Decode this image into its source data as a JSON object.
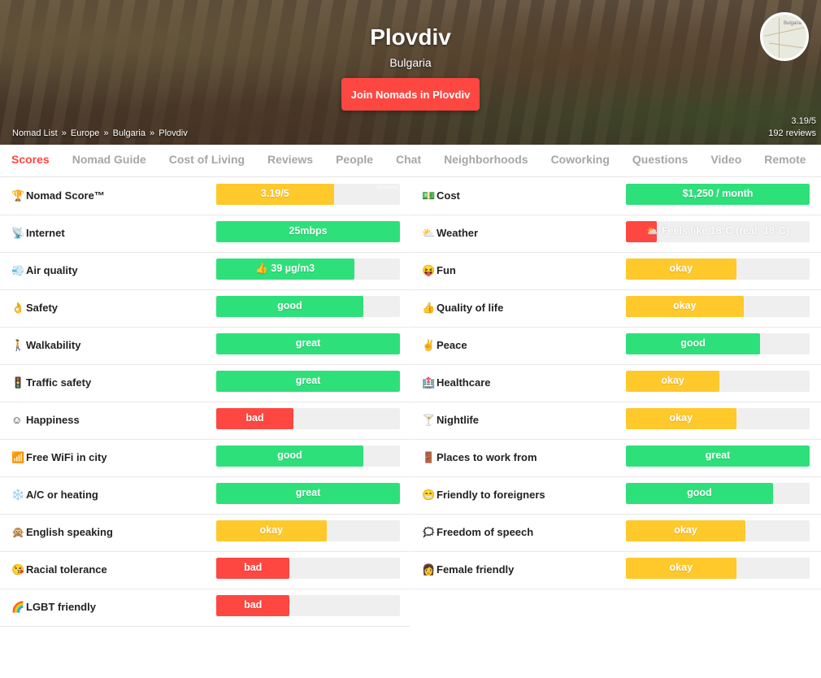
{
  "hero": {
    "city": "Plovdiv",
    "country": "Bulgaria",
    "join_button": "Join Nomads in Plovdiv",
    "map_label": "Bulgaria",
    "breadcrumb": [
      "Nomad List",
      "Europe",
      "Bulgaria",
      "Plovdiv"
    ],
    "breadcrumb_sep": "»",
    "rating": "3.19/5",
    "reviews": "192 reviews"
  },
  "tabs": [
    "Scores",
    "Nomad Guide",
    "Cost of Living",
    "Reviews",
    "People",
    "Chat",
    "Neighborhoods",
    "Coworking",
    "Questions",
    "Video",
    "Remote"
  ],
  "colors": {
    "green": "#2ee07a",
    "yellow": "#ffc82b",
    "red": "#ff4742",
    "track": "#efefef",
    "accent": "#ff4742"
  },
  "left_scores": [
    {
      "icon": "🏆",
      "icon_name": "trophy-icon",
      "label": "Nomad Score™",
      "value": "3.19/5",
      "fill": 0.64,
      "color": "yellow",
      "note": "192 reviews"
    },
    {
      "icon": "📡",
      "icon_name": "satellite-icon",
      "label": "Internet",
      "value": "25mbps",
      "fill": 1.0,
      "color": "green"
    },
    {
      "icon": "💨",
      "icon_name": "wind-icon",
      "label": "Air quality",
      "value": "👍 39 µg/m3",
      "fill": 0.75,
      "color": "green"
    },
    {
      "icon": "👌",
      "icon_name": "ok-hand-icon",
      "label": "Safety",
      "value": "good",
      "fill": 0.8,
      "color": "green"
    },
    {
      "icon": "🚶",
      "icon_name": "walking-person-icon",
      "label": "Walkability",
      "value": "great",
      "fill": 1.0,
      "color": "green"
    },
    {
      "icon": "🚦",
      "icon_name": "traffic-light-icon",
      "label": "Traffic safety",
      "value": "great",
      "fill": 1.0,
      "color": "green"
    },
    {
      "icon": "☺",
      "icon_name": "smile-icon",
      "label": "Happiness",
      "value": "bad",
      "fill": 0.42,
      "color": "red"
    },
    {
      "icon": "📶",
      "icon_name": "wifi-signal-icon",
      "label": "Free WiFi in city",
      "value": "good",
      "fill": 0.8,
      "color": "green"
    },
    {
      "icon": "❄️",
      "icon_name": "snowflake-icon",
      "label": "A/C or heating",
      "value": "great",
      "fill": 1.0,
      "color": "green"
    },
    {
      "icon": "🙊",
      "icon_name": "speak-no-evil-monkey-icon",
      "label": "English speaking",
      "value": "okay",
      "fill": 0.6,
      "color": "yellow"
    },
    {
      "icon": "😘",
      "icon_name": "kiss-face-icon",
      "label": "Racial tolerance",
      "value": "bad",
      "fill": 0.4,
      "color": "red"
    },
    {
      "icon": "🌈",
      "icon_name": "rainbow-icon",
      "label": "LGBT friendly",
      "value": "bad",
      "fill": 0.4,
      "color": "red"
    }
  ],
  "right_scores": [
    {
      "icon": "💵",
      "icon_name": "money-icon",
      "label": "Cost",
      "value": "$1,250 / month",
      "fill": 1.0,
      "color": "green"
    },
    {
      "icon": "⛅",
      "icon_name": "partly-cloudy-icon",
      "label": "Weather",
      "value": "⛅ Feels like 18°C (real: 18°C)",
      "fill": 0.17,
      "color": "red"
    },
    {
      "icon": "😝",
      "icon_name": "tongue-face-icon",
      "label": "Fun",
      "value": "okay",
      "fill": 0.6,
      "color": "yellow"
    },
    {
      "icon": "👍",
      "icon_name": "thumbs-up-icon",
      "label": "Quality of life",
      "value": "okay",
      "fill": 0.64,
      "color": "yellow"
    },
    {
      "icon": "✌️",
      "icon_name": "peace-hand-icon",
      "label": "Peace",
      "value": "good",
      "fill": 0.73,
      "color": "green"
    },
    {
      "icon": "🏥",
      "icon_name": "hospital-icon",
      "label": "Healthcare",
      "value": "okay",
      "fill": 0.51,
      "color": "yellow"
    },
    {
      "icon": "🍸",
      "icon_name": "cocktail-icon",
      "label": "Nightlife",
      "value": "okay",
      "fill": 0.6,
      "color": "yellow"
    },
    {
      "icon": "🚪",
      "icon_name": "door-icon",
      "label": "Places to work from",
      "value": "great",
      "fill": 1.0,
      "color": "green"
    },
    {
      "icon": "😁",
      "icon_name": "grin-face-icon",
      "label": "Friendly to foreigners",
      "value": "good",
      "fill": 0.8,
      "color": "green"
    },
    {
      "icon": "🗯",
      "icon_name": "speech-balloon-icon",
      "label": "Freedom of speech",
      "value": "okay",
      "fill": 0.65,
      "color": "yellow"
    },
    {
      "icon": "👩",
      "icon_name": "woman-icon",
      "label": "Female friendly",
      "value": "okay",
      "fill": 0.6,
      "color": "yellow"
    }
  ]
}
